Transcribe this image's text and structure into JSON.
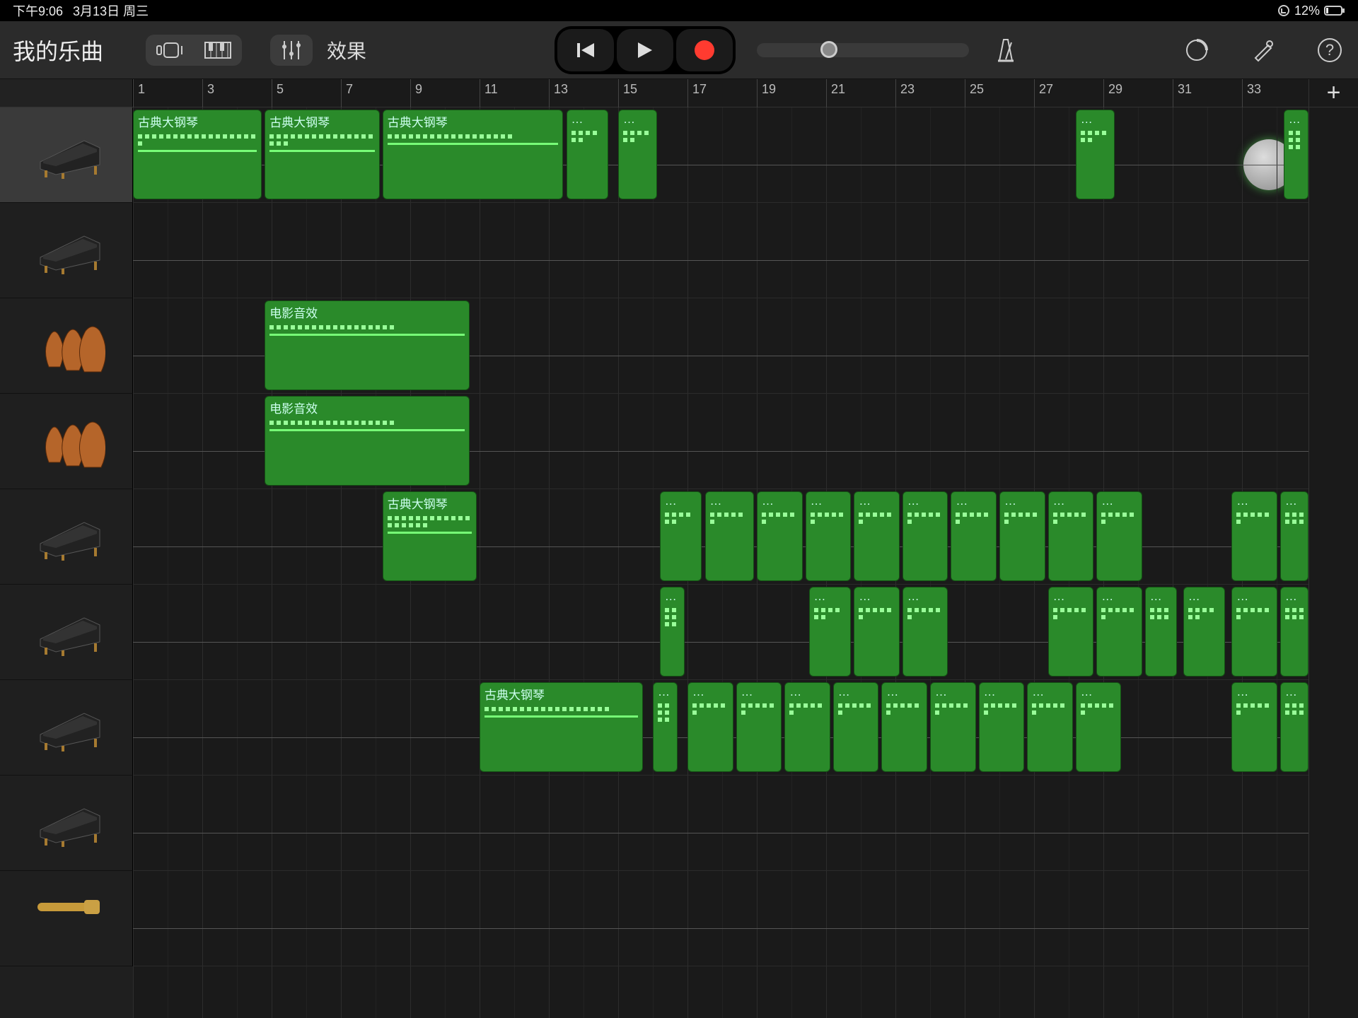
{
  "status": {
    "time": "下午9:06",
    "date": "3月13日 周三",
    "battery_pct": "12%",
    "lock_icon": "orientation-lock"
  },
  "toolbar": {
    "title": "我的乐曲",
    "fx_label": "效果"
  },
  "ruler": {
    "bars": [
      1,
      3,
      5,
      7,
      9,
      11,
      13,
      15,
      17,
      19,
      21,
      23,
      25,
      27,
      29,
      31,
      33
    ]
  },
  "tracks": [
    {
      "instrument": "piano",
      "selected": true
    },
    {
      "instrument": "piano"
    },
    {
      "instrument": "strings"
    },
    {
      "instrument": "strings"
    },
    {
      "instrument": "piano"
    },
    {
      "instrument": "piano"
    },
    {
      "instrument": "piano"
    },
    {
      "instrument": "piano"
    },
    {
      "instrument": "bass"
    }
  ],
  "regions": [
    {
      "track": 0,
      "startBar": 1,
      "endBar": 4.8,
      "label": "古典大钢琴"
    },
    {
      "track": 0,
      "startBar": 4.8,
      "endBar": 8.2,
      "label": "古典大钢琴"
    },
    {
      "track": 0,
      "startBar": 8.2,
      "endBar": 13.5,
      "label": "古典大钢琴"
    },
    {
      "track": 0,
      "startBar": 13.5,
      "endBar": 14.8,
      "label": "…"
    },
    {
      "track": 0,
      "startBar": 15,
      "endBar": 16.2,
      "label": "…"
    },
    {
      "track": 0,
      "startBar": 28.2,
      "endBar": 29.4,
      "label": "…"
    },
    {
      "track": 0,
      "startBar": 34.2,
      "endBar": 35,
      "label": "…"
    },
    {
      "track": 2,
      "startBar": 4.8,
      "endBar": 10.8,
      "label": "电影音效"
    },
    {
      "track": 3,
      "startBar": 4.8,
      "endBar": 10.8,
      "label": "电影音效"
    },
    {
      "track": 4,
      "startBar": 8.2,
      "endBar": 11,
      "label": "古典大钢琴"
    },
    {
      "track": 4,
      "startBar": 16.2,
      "endBar": 17.5,
      "label": "…"
    },
    {
      "track": 4,
      "startBar": 17.5,
      "endBar": 19,
      "label": "…"
    },
    {
      "track": 4,
      "startBar": 19,
      "endBar": 20.4,
      "label": "…"
    },
    {
      "track": 4,
      "startBar": 20.4,
      "endBar": 21.8,
      "label": "…"
    },
    {
      "track": 4,
      "startBar": 21.8,
      "endBar": 23.2,
      "label": "…"
    },
    {
      "track": 4,
      "startBar": 23.2,
      "endBar": 24.6,
      "label": "…"
    },
    {
      "track": 4,
      "startBar": 24.6,
      "endBar": 26,
      "label": "…"
    },
    {
      "track": 4,
      "startBar": 26,
      "endBar": 27.4,
      "label": "…"
    },
    {
      "track": 4,
      "startBar": 27.4,
      "endBar": 28.8,
      "label": "…"
    },
    {
      "track": 4,
      "startBar": 28.8,
      "endBar": 30.2,
      "label": "…"
    },
    {
      "track": 4,
      "startBar": 32.7,
      "endBar": 34.1,
      "label": "…"
    },
    {
      "track": 4,
      "startBar": 34.1,
      "endBar": 35,
      "label": "…"
    },
    {
      "track": 5,
      "startBar": 16.2,
      "endBar": 17,
      "label": "…"
    },
    {
      "track": 5,
      "startBar": 20.5,
      "endBar": 21.8,
      "label": "…"
    },
    {
      "track": 5,
      "startBar": 21.8,
      "endBar": 23.2,
      "label": "…"
    },
    {
      "track": 5,
      "startBar": 23.2,
      "endBar": 24.6,
      "label": "…"
    },
    {
      "track": 5,
      "startBar": 27.4,
      "endBar": 28.8,
      "label": "…"
    },
    {
      "track": 5,
      "startBar": 28.8,
      "endBar": 30.2,
      "label": "…"
    },
    {
      "track": 5,
      "startBar": 30.2,
      "endBar": 31.2,
      "label": "…"
    },
    {
      "track": 5,
      "startBar": 31.3,
      "endBar": 32.6,
      "label": "…"
    },
    {
      "track": 5,
      "startBar": 32.7,
      "endBar": 34.1,
      "label": "…"
    },
    {
      "track": 5,
      "startBar": 34.1,
      "endBar": 35,
      "label": "…"
    },
    {
      "track": 6,
      "startBar": 11,
      "endBar": 15.8,
      "label": "古典大钢琴"
    },
    {
      "track": 6,
      "startBar": 16,
      "endBar": 16.8,
      "label": "…"
    },
    {
      "track": 6,
      "startBar": 17,
      "endBar": 18.4,
      "label": "…"
    },
    {
      "track": 6,
      "startBar": 18.4,
      "endBar": 19.8,
      "label": "…"
    },
    {
      "track": 6,
      "startBar": 19.8,
      "endBar": 21.2,
      "label": "…"
    },
    {
      "track": 6,
      "startBar": 21.2,
      "endBar": 22.6,
      "label": "…"
    },
    {
      "track": 6,
      "startBar": 22.6,
      "endBar": 24,
      "label": "…"
    },
    {
      "track": 6,
      "startBar": 24,
      "endBar": 25.4,
      "label": "…"
    },
    {
      "track": 6,
      "startBar": 25.4,
      "endBar": 26.8,
      "label": "…"
    },
    {
      "track": 6,
      "startBar": 26.8,
      "endBar": 28.2,
      "label": "…"
    },
    {
      "track": 6,
      "startBar": 28.2,
      "endBar": 29.6,
      "label": "…"
    },
    {
      "track": 6,
      "startBar": 32.7,
      "endBar": 34.1,
      "label": "…"
    },
    {
      "track": 6,
      "startBar": 34.1,
      "endBar": 35,
      "label": "…"
    }
  ],
  "colors": {
    "region_green": "#2a8a2a",
    "region_border": "#145014",
    "record_red": "#ff3b30"
  }
}
